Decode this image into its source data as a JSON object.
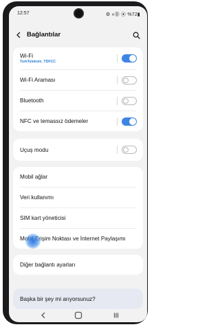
{
  "status_bar": {
    "time": "12:57",
    "indicators": "⚙ »Ⓓ ⦿ %72▮"
  },
  "header": {
    "title": "Bağlantılar"
  },
  "groups": [
    {
      "items": [
        {
          "title": "Wi-Fi",
          "subtitle": "TurkTelekom_TDFCC",
          "toggle": "on"
        },
        {
          "title": "Wi-Fi Araması",
          "toggle": "off"
        },
        {
          "title": "Bluetooth",
          "toggle": "off"
        },
        {
          "title": "NFC ve temassız ödemeler",
          "toggle": "on"
        }
      ]
    },
    {
      "items": [
        {
          "title": "Uçuş modu",
          "toggle": "off"
        }
      ]
    },
    {
      "items": [
        {
          "title": "Mobil ağlar"
        },
        {
          "title": "Veri kullanımı"
        },
        {
          "title": "SIM kart yöneticisi"
        },
        {
          "title": "Mobil Erişim Noktası ve İnternet Paylaşımı"
        }
      ]
    },
    {
      "items": [
        {
          "title": "Diğer bağlantı ayarları"
        }
      ]
    }
  ],
  "suggestion": {
    "label": "Başka bir şey mi arıyorsunuz?"
  },
  "nav_bar": {
    "back_icon": "chevron-left-icon",
    "home_icon": "home-icon",
    "recents_icon": "recents-icon"
  },
  "colors": {
    "accent": "#3e86e6",
    "subtitle": "#2a7ed8",
    "background": "#f2f2f2",
    "card": "#ffffff",
    "suggestion_bg": "#e6e9f1"
  }
}
